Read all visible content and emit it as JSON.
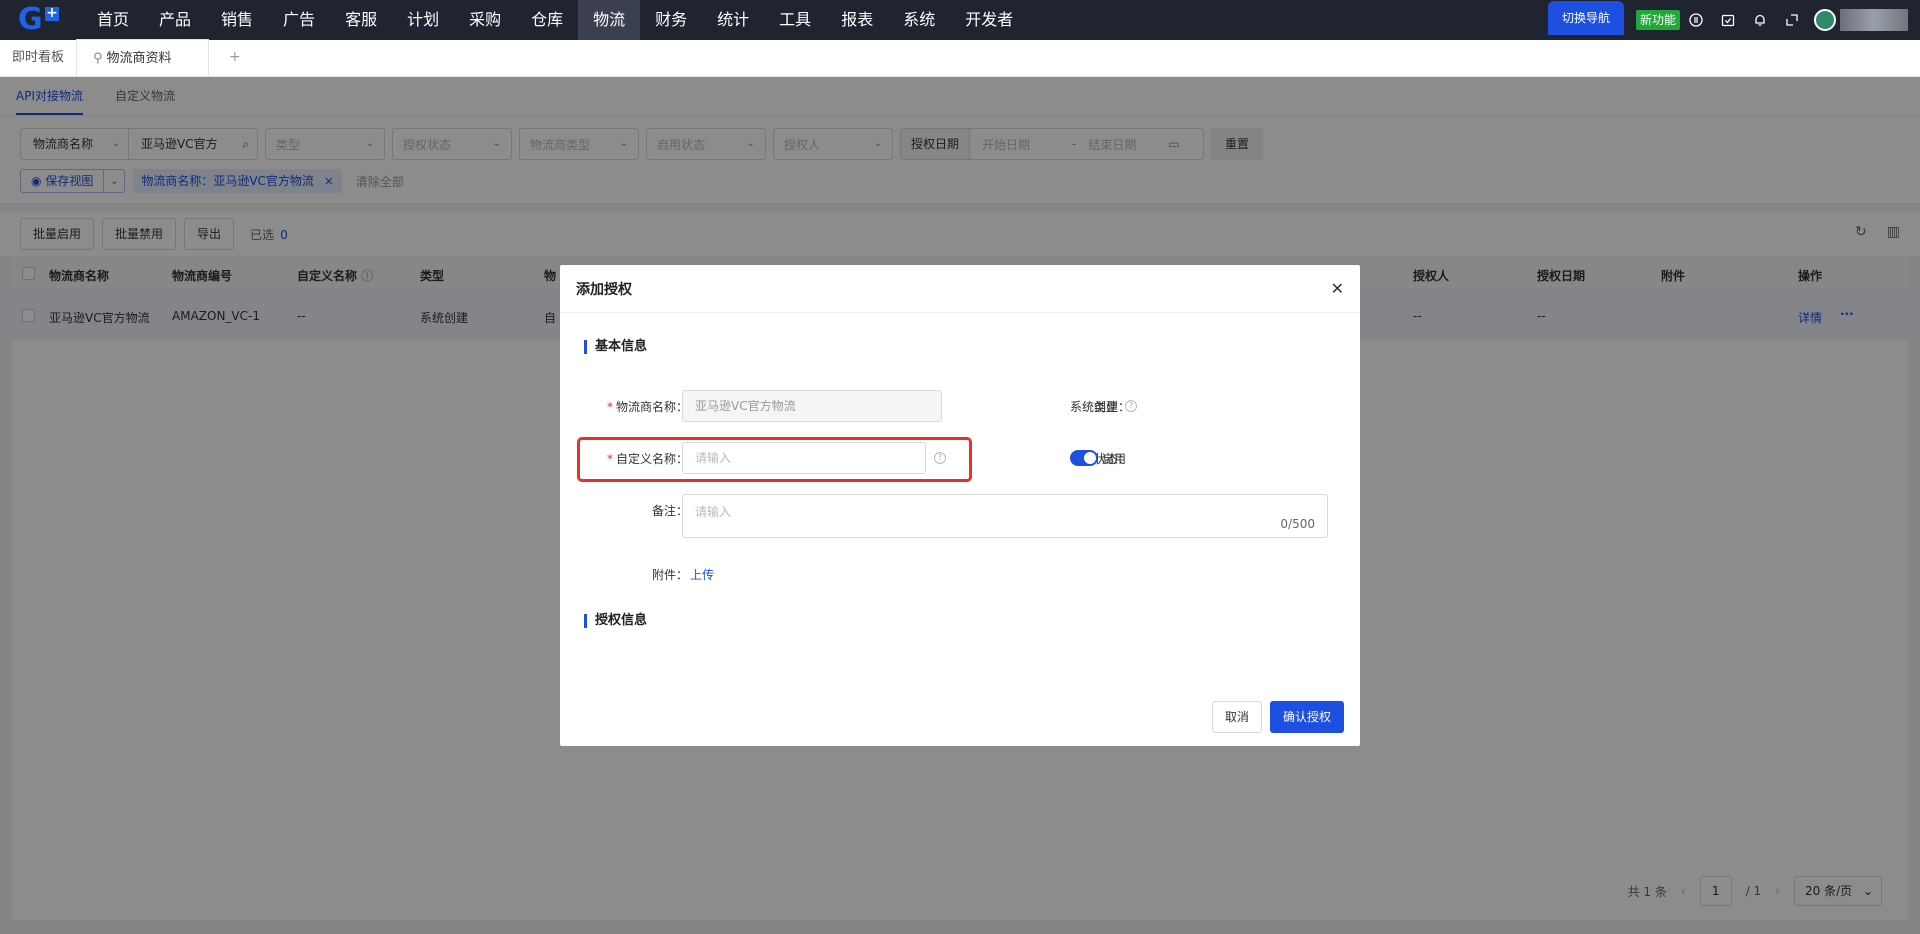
{
  "nav": {
    "items": [
      "首页",
      "产品",
      "销售",
      "广告",
      "客服",
      "计划",
      "采购",
      "仓库",
      "物流",
      "财务",
      "统计",
      "工具",
      "报表",
      "系统",
      "开发者"
    ],
    "switch_nav": "切换导航",
    "new_feature": "新功能"
  },
  "tabs": {
    "dashboard": "即时看板",
    "active": "物流商资料",
    "add": "+"
  },
  "subtabs": [
    "API对接物流",
    "自定义物流"
  ],
  "filters": {
    "field_select": "物流商名称",
    "field_value": "亚马逊VC官方",
    "type": "类型",
    "auth_status": "授权状态",
    "provider_type": "物流商类型",
    "enable_status": "启用状态",
    "authorizer": "授权人",
    "auth_date": "授权日期",
    "start_date": "开始日期",
    "date_sep": "-",
    "end_date": "结束日期",
    "reset": "重置",
    "save_view": "保存视图",
    "tag": "物流商名称：亚马逊VC官方物流",
    "clear_all": "清除全部"
  },
  "toolbar": {
    "batch_enable": "批量启用",
    "batch_disable": "批量禁用",
    "export": "导出",
    "selected_label": "已选",
    "selected_count": "0"
  },
  "table": {
    "headers": {
      "name": "物流商名称",
      "code": "物流商编号",
      "custom": "自定义名称",
      "type": "类型",
      "wu": "物",
      "authorizer": "授权人",
      "auth_date": "授权日期",
      "attachment": "附件",
      "ops": "操作"
    },
    "row": {
      "name": "亚马逊VC官方物流",
      "code": "AMAZON_VC-1",
      "custom": "--",
      "type": "系统创建",
      "zi": "自",
      "authorizer": "--",
      "auth_date": "--",
      "detail": "详情",
      "more": "···"
    }
  },
  "pager": {
    "total": "共 1 条",
    "page": "1",
    "of": "/  1",
    "size": "20 条/页"
  },
  "modal": {
    "title": "添加授权",
    "basic_section": "基本信息",
    "provider_label": "物流商名称：",
    "provider_value": "亚马逊VC官方物流",
    "type_label": "类型：",
    "type_value": "系统创建",
    "custom_label": "自定义名称：",
    "custom_placeholder": "请输入",
    "status_label": "状态：",
    "status_value": "启用",
    "remark_label": "备注：",
    "remark_placeholder": "请输入",
    "remark_counter": "0/500",
    "attach_label": "附件：",
    "upload": "上传",
    "auth_section": "授权信息",
    "cancel": "取消",
    "confirm": "确认授权"
  }
}
